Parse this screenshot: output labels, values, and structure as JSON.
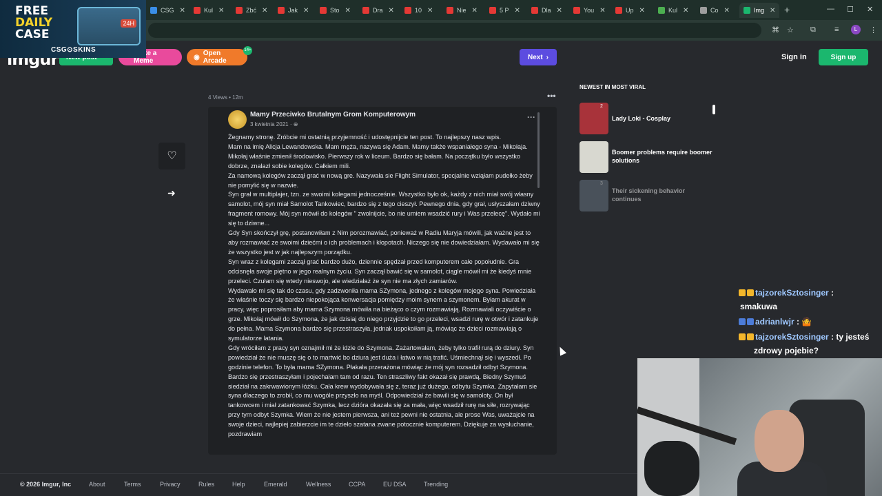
{
  "browser": {
    "tabs": [
      {
        "label": "CSG",
        "color": "#3a8ee6"
      },
      {
        "label": "Kul",
        "color": "#e53935"
      },
      {
        "label": "Zbć",
        "color": "#e53935"
      },
      {
        "label": "Jak",
        "color": "#e53935"
      },
      {
        "label": "Sto",
        "color": "#e53935"
      },
      {
        "label": "Dra",
        "color": "#e53935"
      },
      {
        "label": "10",
        "color": "#e53935"
      },
      {
        "label": "Nie",
        "color": "#e53935"
      },
      {
        "label": "5 P",
        "color": "#e53935"
      },
      {
        "label": "Dla",
        "color": "#e53935"
      },
      {
        "label": "You",
        "color": "#e53935"
      },
      {
        "label": "Up",
        "color": "#e53935"
      },
      {
        "label": "Kul",
        "color": "#4caf50"
      },
      {
        "label": "Co",
        "color": "#9e9e9e"
      },
      {
        "label": "Img",
        "color": "#1bb76e"
      }
    ],
    "new_tab": "+",
    "min": "—",
    "max": "☐",
    "close": "✕",
    "profile": "L"
  },
  "ad": {
    "line1": "FREE",
    "line2": "DAILY",
    "line3": "CASE",
    "box_label": "24H",
    "brand": "CSG⊙SKINS"
  },
  "header": {
    "logo": "imgur",
    "new_post": "New post",
    "make_meme": "Make a Meme",
    "open_arcade": "Open Arcade",
    "arcade_badge": "14+",
    "next": "Next",
    "sign_in": "Sign in",
    "sign_up": "Sign up"
  },
  "post": {
    "meta": "4 Views • 12m",
    "author": "Mamy Przeciwko Brutalnym Grom Komputerowym",
    "date": "3 kwietnia 2021 · ",
    "body": "Żegnamy stronę. Zróbcie mi ostatnią przyjemność i udostępnijcie ten post. To najlepszy nasz wpis.\nMam na imię Alicja Lewandowska. Mam męża, nazywa się Adam. Mamy także wspaniałego syna - Mikołaja. Mikołaj właśnie zmienił środowisko. Pierwszy rok w liceum. Bardzo się bałam. Na początku było wszystko dobrze, znalazł sobie kolegów. Całkiem mili.\nZa namową kolegów zaczął grać w nową gre. Nazywała sie Flight Simulator, specjalnie wziąłam pudełko żeby nie pomylić się w nazwie.\nSyn grał w multiplajer, tzn. ze swoimi kolegami jednocześnie. Wszystko było ok, każdy z nich miał swój własny samolot, mój syn miał Samolot Tankowiec, bardzo się z tego cieszył. Pewnego dnia, gdy grał, usłyszałam dziwny fragment romowy. Mój syn mówił do kolegów \" zwolnijcie, bo nie umiem wsadzić rury i Was przelecę\". Wydało mi się to dziwne...\nGdy Syn skończył grę, postanowiłam z Nim porozmawiać, ponieważ w Radiu Maryja mówili, jak ważne jest to aby rozmawiać ze swoimi dziećmi o ich problemach i kłopotach. Niczego się nie dowiedziałam. Wydawało mi się że wszystko jest w jak najlepszym porządku.\nSyn wraz z kolegami zaczął grać bardzo dużo, dziennie spędzał przed komputerem całe popołudnie. Gra odcisnęła swoje piętno w jego realnym życiu. Syn zaczął bawić się w samolot, ciągle mówił mi że kiedyś mnie przeleci. Czułam się wtedy nieswojo, ale wiedziałaż że syn nie ma złych zamiarów.\nWydawało mi się tak do czasu, gdy zadzwoniła mama SZymona, jednego z kolegów mojego syna. Powiedziała że właśnie toczy się bardzo niepokojąca konwersacja pomiędzy moim synem a szymonem. Byłam akurat w pracy, więc poprosiłam aby mama Szymona mówiła na bieżąco o czym rozmawiają. Rozmawiali oczywiście o grze. Mikołaj mówił do Szymona, że jak dzisiaj do niego przyjdzie to go przeleci, wsadzi rurę w otwór i zatankuje do pełna. Mama Szymona bardzo się przestraszyła, jednak uspokoiłam ją, mówiąc że dzieci rozmawiają o symulatorze latania.\nGdy wróciłam z pracy syn oznajmił mi że idzie do Szymona. Zażartowałam, żeby tylko trafił rurą do dziury. Syn powiedział że nie muszę się o to martwić bo dziura jest duża i łatwo w nią trafić. Uśmiechnął się i wyszedł. Po godzinie telefon. To była mama SZymona. Płakała przerażona mówiąc że mój syn rozsadził odbyt Szymona. Bardzo się przestraszyłam i pojechałam tam od razu. Ten straszliwy fakt okazał się prawdą. Biedny Szymuś siedział na zakrwawionym łóżku. Cała krew wydobywała się z, teraz już dużego, odbytu Szymka. Zapytałam sie syna dlaczego to zrobił, co mu wogóle przyszło na myśl. Odpowiedział że bawili się w samoloty. On był tankowcem i miał zatankować Szymka, lecz dzióra okazała się za mała, więc wsadził rurę na siłe, rozrywając przy tym odbyt Szymka. Wiem że nie jestem pierwsza, ani też pewni nie ostatnia, ale prose Was, uważajcie na swoje dzieci, najlepiej zabierzcie im te dzieło szatana zwane potocznie komputerem. Dziękuje za wysłuchanie, pozdrawiam"
  },
  "viral": {
    "title": "NEWEST IN MOST VIRAL",
    "items": [
      {
        "num": "2",
        "label": "Lady Loki - Cosplay",
        "color": "#a8333a"
      },
      {
        "num": "",
        "label": "Boomer problems require boomer solutions",
        "color": "#d8d8d0"
      },
      {
        "num": "3",
        "label": "Their sickening behavior continues",
        "color": "#6b7a88"
      }
    ]
  },
  "chat": [
    {
      "user": "tajzorekSztosinger",
      "msg": ":"
    },
    {
      "user": "",
      "msg": "smakuwa"
    },
    {
      "user": "adrianlwjr",
      "msg": ": 🤷"
    },
    {
      "user": "tajzorekSztosinger",
      "msg": ": ty jesteś"
    },
    {
      "user": "",
      "msg": "zdrowy pojebie?"
    }
  ],
  "footer": {
    "copyright": "© 2026 Imgur, Inc",
    "links": [
      "About",
      "Terms",
      "Privacy",
      "Rules",
      "Help",
      "Emerald",
      "Wellness",
      "CCPA",
      "EU DSA",
      "Trending"
    ]
  }
}
